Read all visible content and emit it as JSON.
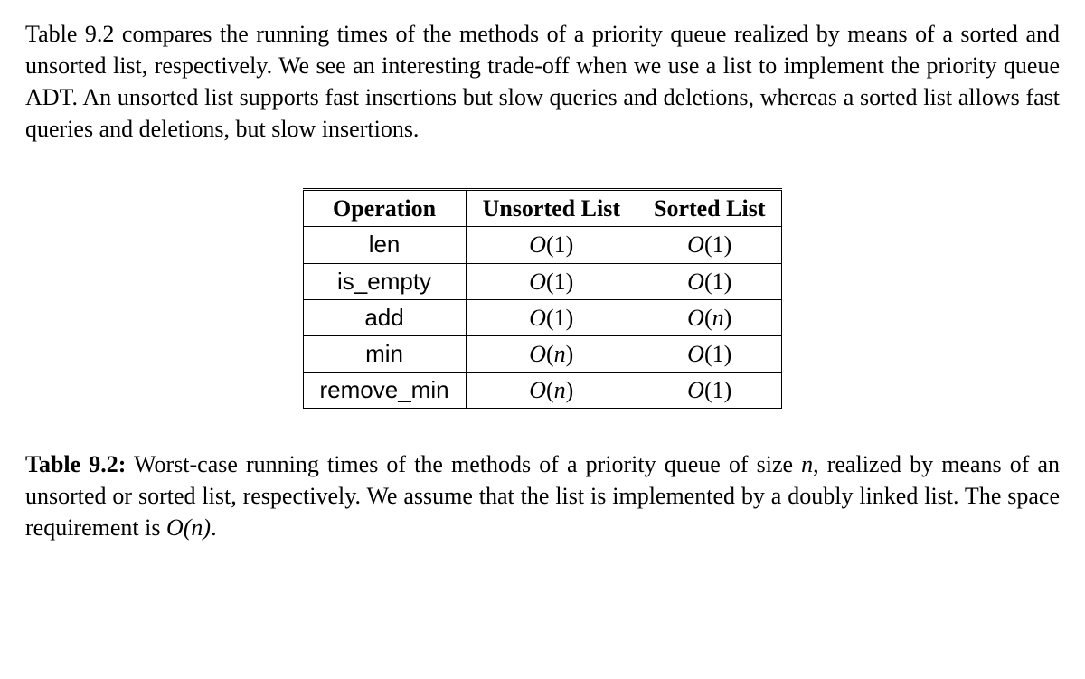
{
  "paragraph": "Table 9.2 compares the running times of the methods of a priority queue realized by means of a sorted and unsorted list, respectively.  We see an interesting trade-off when we use a list to implement the priority queue ADT.  An unsorted list supports fast insertions but slow queries and deletions, whereas a sorted list allows fast queries and deletions, but slow insertions.",
  "chart_data": {
    "type": "table",
    "headers": [
      "Operation",
      "Unsorted List",
      "Sorted List"
    ],
    "rows": [
      {
        "operation": "len",
        "unsorted": "O(1)",
        "sorted": "O(1)"
      },
      {
        "operation": "is_empty",
        "unsorted": "O(1)",
        "sorted": "O(1)"
      },
      {
        "operation": "add",
        "unsorted": "O(1)",
        "sorted": "O(n)"
      },
      {
        "operation": "min",
        "unsorted": "O(n)",
        "sorted": "O(1)"
      },
      {
        "operation": "remove_min",
        "unsorted": "O(n)",
        "sorted": "O(1)"
      }
    ]
  },
  "caption": {
    "label": "Table 9.2:",
    "text_before_n1": " Worst-case running times of the methods of a priority queue of size ",
    "n1": "n",
    "text_mid": ", realized by means of an unsorted or sorted list, respectively.  We assume that the list is implemented by a doubly linked list. The space requirement is ",
    "big_o_n": "O(n)",
    "text_after": "."
  }
}
